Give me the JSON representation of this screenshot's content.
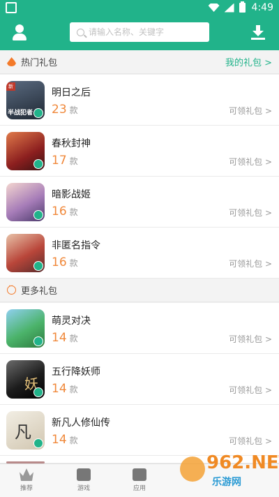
{
  "statusbar": {
    "time": "4:49"
  },
  "search": {
    "placeholder": "请输入名称、关键字"
  },
  "hot_section": {
    "title": "热门礼包",
    "link": "我的礼包 >"
  },
  "more_section": {
    "title": "更多礼包"
  },
  "unit_label": "款",
  "claim_label": "可领礼包 >",
  "hot_items": [
    {
      "name": "明日之后",
      "count": "23",
      "thumb_color": "#3d4a5c"
    },
    {
      "name": "春秋封神",
      "count": "17",
      "thumb_color": "#b03a2e"
    },
    {
      "name": "暗影战姬",
      "count": "16",
      "thumb_color": "#8a6d9e"
    },
    {
      "name": "非匿名指令",
      "count": "16",
      "thumb_color": "#c2503b"
    }
  ],
  "more_items": [
    {
      "name": "萌灵对决",
      "count": "14",
      "thumb_color": "#3fa55b"
    },
    {
      "name": "五行降妖师",
      "count": "14",
      "thumb_color": "#2a2a2a"
    },
    {
      "name": "新凡人修仙传",
      "count": "14",
      "thumb_color": "#d9d2c2"
    }
  ],
  "thumb_texts": {
    "game1_overlay": "半战犯者"
  },
  "bottom_nav": [
    {
      "label": "推荐",
      "icon": "crown-icon"
    },
    {
      "label": "游戏",
      "icon": "gamepad-icon"
    },
    {
      "label": "应用",
      "icon": "magnet-icon"
    }
  ],
  "watermark": {
    "big": "962.NET",
    "small": "乐游网"
  }
}
